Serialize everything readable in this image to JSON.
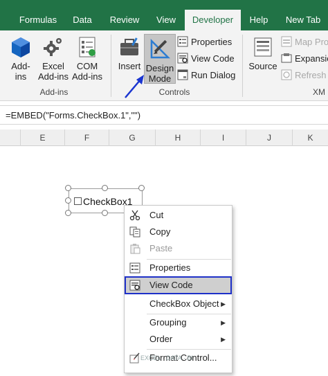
{
  "ribbon": {
    "tabs": [
      {
        "label": "Formulas",
        "active": false
      },
      {
        "label": "Data",
        "active": false
      },
      {
        "label": "Review",
        "active": false
      },
      {
        "label": "View",
        "active": false
      },
      {
        "label": "Developer",
        "active": true
      },
      {
        "label": "Help",
        "active": false
      },
      {
        "label": "New Tab",
        "active": false
      }
    ],
    "addins_group": {
      "label": "Add-ins",
      "buttons": [
        {
          "line1": "Add-",
          "line2": "ins",
          "icon": "addins-cube-icon"
        },
        {
          "line1": "Excel",
          "line2": "Add-ins",
          "icon": "gear-icon"
        },
        {
          "line1": "COM",
          "line2": "Add-ins",
          "icon": "com-addins-icon"
        }
      ]
    },
    "controls_group": {
      "label": "Controls",
      "insert_label": "Insert",
      "design_mode_line1": "Design",
      "design_mode_line2": "Mode",
      "properties_label": "Properties",
      "view_code_label": "View Code",
      "run_dialog_label": "Run Dialog"
    },
    "xml_group": {
      "label": "XM",
      "source_label": "Source",
      "map_properties_label": "Map Pros",
      "expansion_label": "Expansio",
      "refresh_label": "Refresh D"
    }
  },
  "formula_bar": {
    "text": "=EMBED(\"Forms.CheckBox.1\",\"\")"
  },
  "columns": [
    "E",
    "F",
    "G",
    "H",
    "I",
    "J",
    "K"
  ],
  "checkbox": {
    "label": "CheckBox1"
  },
  "context_menu": {
    "items": [
      {
        "label": "Cut",
        "icon": "scissors-icon",
        "disabled": false
      },
      {
        "label": "Copy",
        "icon": "copy-icon",
        "disabled": false
      },
      {
        "label": "Paste",
        "icon": "paste-icon",
        "disabled": true
      },
      {
        "label": "Properties",
        "icon": "properties-icon",
        "disabled": false
      },
      {
        "label": "View Code",
        "icon": "view-code-icon",
        "disabled": false,
        "highlighted": true
      },
      {
        "label": "CheckBox Object",
        "submenu": true
      },
      {
        "label": "Grouping",
        "submenu": true
      },
      {
        "label": "Order",
        "submenu": true
      },
      {
        "label": "Format Control...",
        "icon": "format-control-icon",
        "disabled": false
      }
    ]
  },
  "watermark": "EXCEL · DATA · BI",
  "colors": {
    "excel_green": "#217346",
    "highlight_border": "#1e30c8",
    "arrow_blue": "#1a35d0"
  }
}
